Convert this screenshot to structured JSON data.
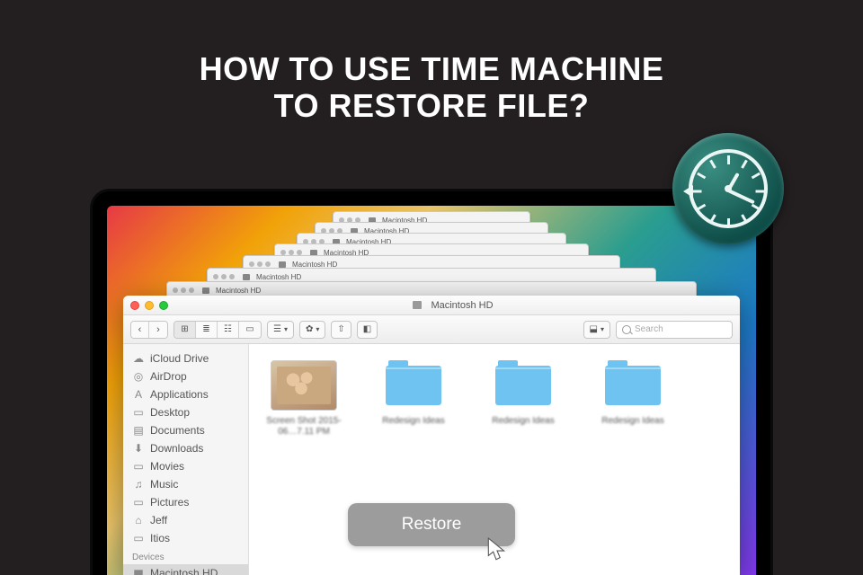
{
  "heading_line1": "HOW TO USE TIME MACHINE",
  "heading_line2": "TO RESTORE FILE?",
  "stacked_title": "Macintosh HD",
  "finder": {
    "title": "Macintosh HD",
    "search_placeholder": "Search",
    "sidebar": {
      "items": [
        {
          "label": "iCloud Drive",
          "icon": "cloud"
        },
        {
          "label": "AirDrop",
          "icon": "airdrop"
        },
        {
          "label": "Applications",
          "icon": "apps"
        },
        {
          "label": "Desktop",
          "icon": "desktop"
        },
        {
          "label": "Documents",
          "icon": "doc"
        },
        {
          "label": "Downloads",
          "icon": "download"
        },
        {
          "label": "Movies",
          "icon": "movie"
        },
        {
          "label": "Music",
          "icon": "music"
        },
        {
          "label": "Pictures",
          "icon": "picture"
        },
        {
          "label": "Jeff",
          "icon": "home"
        },
        {
          "label": "Itios",
          "icon": "folder"
        }
      ],
      "devices_header": "Devices",
      "devices": [
        {
          "label": "Macintosh HD",
          "icon": "hd"
        }
      ]
    },
    "files": [
      {
        "label": "Screen Shot 2015-06…7.11 PM",
        "type": "photo"
      },
      {
        "label": "Redesign Ideas",
        "type": "folder"
      },
      {
        "label": "Redesign Ideas",
        "type": "folder"
      },
      {
        "label": "Redesign Ideas",
        "type": "folder"
      }
    ]
  },
  "restore_label": "Restore",
  "icons": {
    "cloud": "☁",
    "airdrop": "◎",
    "apps": "A",
    "desktop": "▭",
    "doc": "▤",
    "download": "⬇",
    "movie": "▭",
    "music": "♫",
    "picture": "▭",
    "home": "⌂",
    "folder": "▭",
    "hd": "▆",
    "grid": "⊞",
    "list": "≣",
    "col": "☷",
    "cover": "▭",
    "group": "☰",
    "gear": "✿",
    "share": "⇧",
    "dbx": "⬓",
    "tag": "◧"
  }
}
